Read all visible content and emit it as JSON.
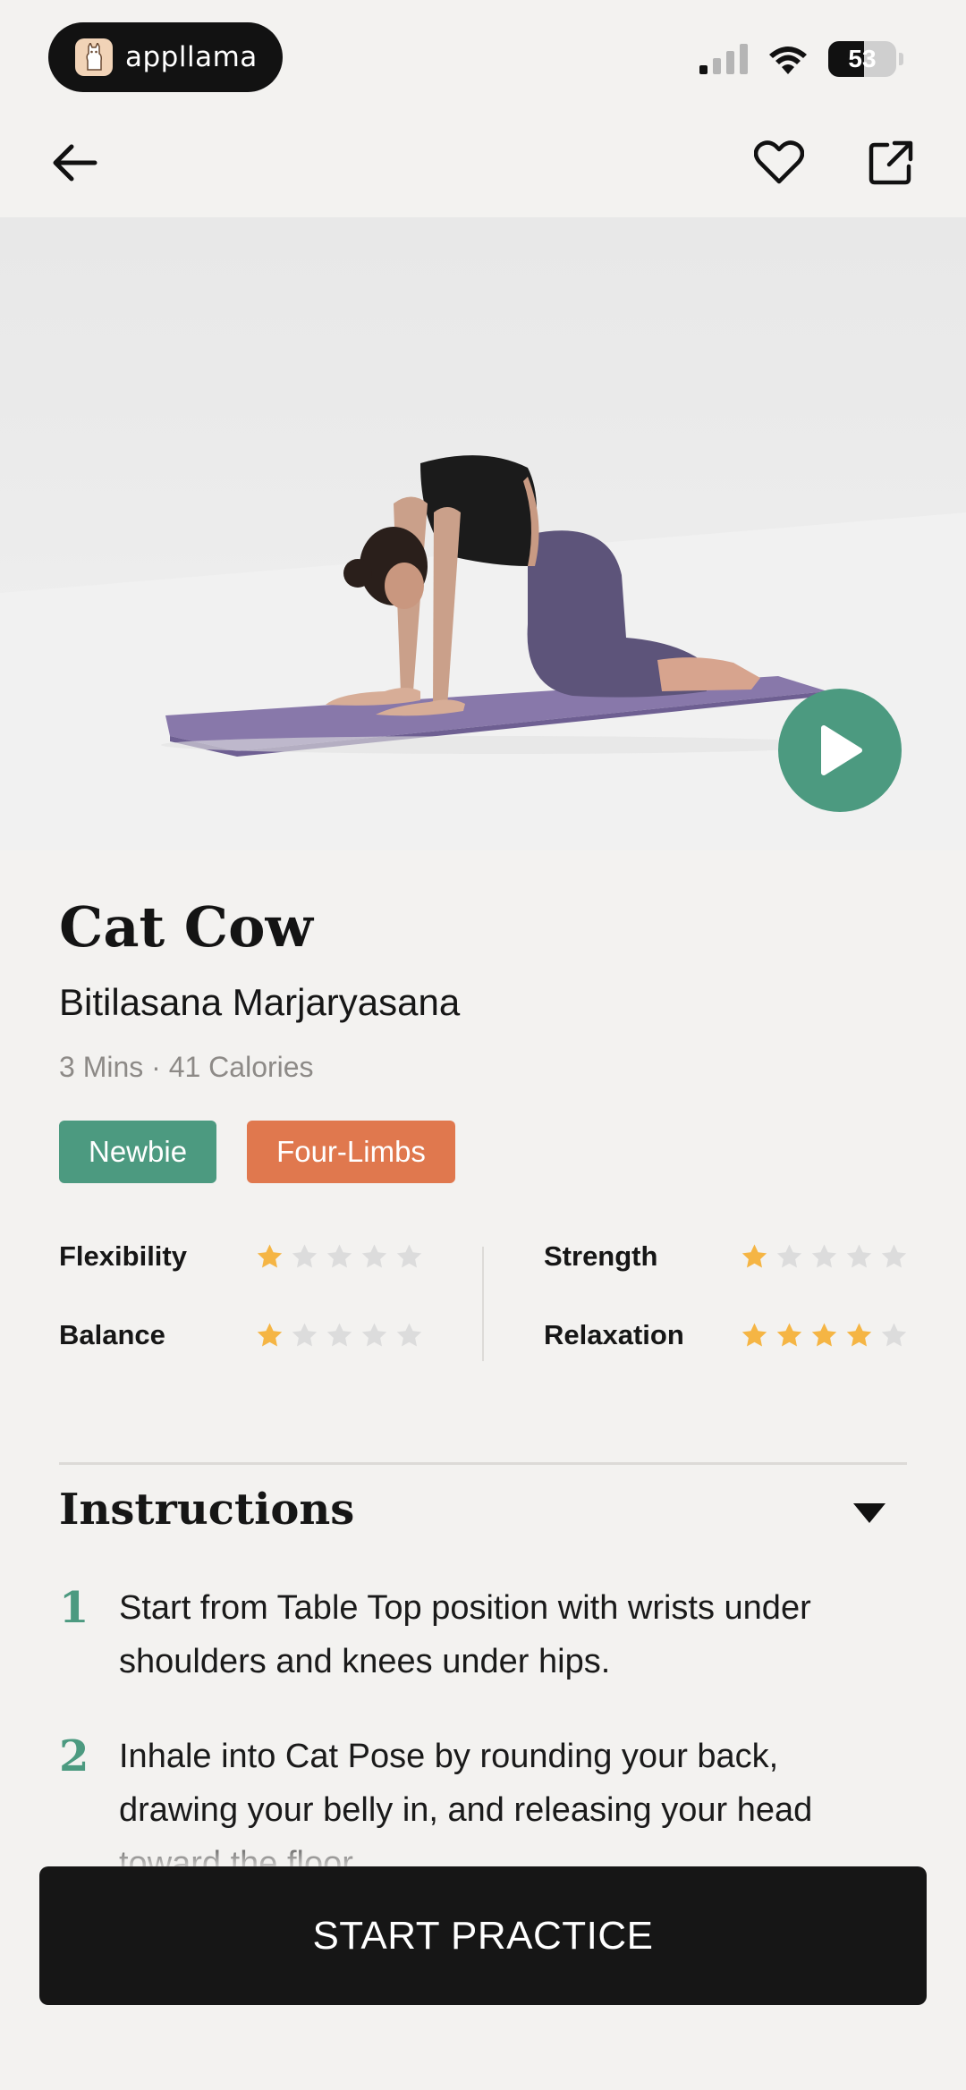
{
  "status_bar": {
    "app_name": "appllama",
    "battery_level": "53",
    "battery_fill_fraction": 0.53,
    "signal_icon": "cellular-signal-icon",
    "wifi_icon": "wifi-icon"
  },
  "nav": {
    "back_icon": "arrow-left-icon",
    "favorite_icon": "heart-outline-icon",
    "share_icon": "share-external-icon"
  },
  "hero": {
    "image": "yoga-cat-pose-photo",
    "play_icon": "play-icon"
  },
  "pose": {
    "title": "Cat Cow",
    "subtitle": "Bitilasana Marjaryasana",
    "meta": "3 Mins · 41 Calories"
  },
  "tags": [
    {
      "label": "Newbie",
      "color": "#4c9a80"
    },
    {
      "label": "Four-Limbs",
      "color": "#e0784e"
    }
  ],
  "ratings": [
    {
      "label": "Flexibility",
      "stars": 1,
      "max": 5
    },
    {
      "label": "Strength",
      "stars": 1,
      "max": 5
    },
    {
      "label": "Balance",
      "stars": 1,
      "max": 5
    },
    {
      "label": "Relaxation",
      "stars": 4,
      "max": 5
    }
  ],
  "instructions": {
    "title": "Instructions",
    "toggle_icon": "triangle-down-icon",
    "steps": [
      {
        "number": "1",
        "text": "Start from Table Top position with wrists under shoulders and knees under hips."
      },
      {
        "number": "2",
        "text": "Inhale into Cat Pose by rounding your back, drawing your belly in, and releasing your head toward the floor."
      }
    ]
  },
  "cta": {
    "label": "START PRACTICE"
  },
  "colors": {
    "accent_green": "#4c9a80",
    "accent_orange": "#e0784e",
    "star_filled": "#f5b544",
    "star_empty": "#dcdcdc",
    "background": "#f3f2f0"
  }
}
